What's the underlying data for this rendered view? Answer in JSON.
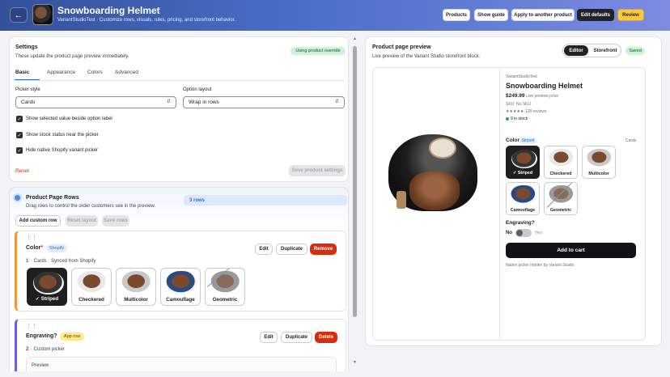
{
  "header": {
    "back_icon": "arrow-left-icon",
    "title": "Snowboarding Helmet",
    "subtitle": "VariantStudioTest · Customize rows, visuals, rules, pricing, and storefront behavior.",
    "buttons": [
      "Products",
      "Show guide",
      "Apply to another product",
      "Edit defaults",
      "Review"
    ]
  },
  "settings": {
    "title": "Settings",
    "desc": "These update the product page preview immediately.",
    "badge": "Using product override",
    "tabs": [
      "Basic",
      "Appearance",
      "Colors",
      "Advanced"
    ],
    "picker_style": {
      "label": "Picker style",
      "value": "Cards"
    },
    "option_layout": {
      "label": "Option layout",
      "value": "Wrap in rows"
    },
    "checks": [
      "Show selected value beside option label",
      "Show stock status near the picker",
      "Hide native Shopify variant picker"
    ],
    "reset": "Reset",
    "save": "Save product settings"
  },
  "rows": {
    "title": "Product Page Rows",
    "desc": "Drag rows to control the order customers see in the preview.",
    "count": "3 rows",
    "add": "Add custom row",
    "reset_layout": "Reset layout",
    "save": "Save rows",
    "color_row": {
      "name": "Color",
      "star": "*",
      "badge": "Shopify",
      "index": "1",
      "meta": "· Cards · Synced from Shopify",
      "edit": "Edit",
      "duplicate": "Duplicate",
      "remove": "Remove",
      "swatches": [
        "✓ Striped",
        "Checkered",
        "Multicolor",
        "Camouflage",
        "Geometric"
      ]
    },
    "engraving_row": {
      "name": "Engraving?",
      "badge": "App row",
      "index": "2",
      "meta": "· Custom picker",
      "edit": "Edit",
      "duplicate": "Duplicate",
      "delete": "Delete",
      "preview": "Preview"
    }
  },
  "preview": {
    "title": "Product page preview",
    "desc": "Live preview of the Variant Studio storefront block.",
    "toggle": [
      "Editor",
      "Storefront"
    ],
    "saved": "Saved",
    "store": "VariantStudioTest",
    "product": "Snowboarding Helmet",
    "price": "$249.99",
    "price_note": "Live preview price",
    "sku": "SKU: No SKU",
    "reviews": "★★★★★ 128 reviews",
    "stock": "9 in stock",
    "color_label": "Color",
    "color_selected": "Striped",
    "style_label": "Cards",
    "swatches": [
      "✓ Striped",
      "Checkered",
      "Multicolor",
      "Camouflage",
      "Geometric"
    ],
    "engraving_label": "Engraving?",
    "no": "No",
    "yes": "Yes",
    "cart": "Add to cart",
    "native_note": "Native picker hidden by Variant Studio"
  }
}
